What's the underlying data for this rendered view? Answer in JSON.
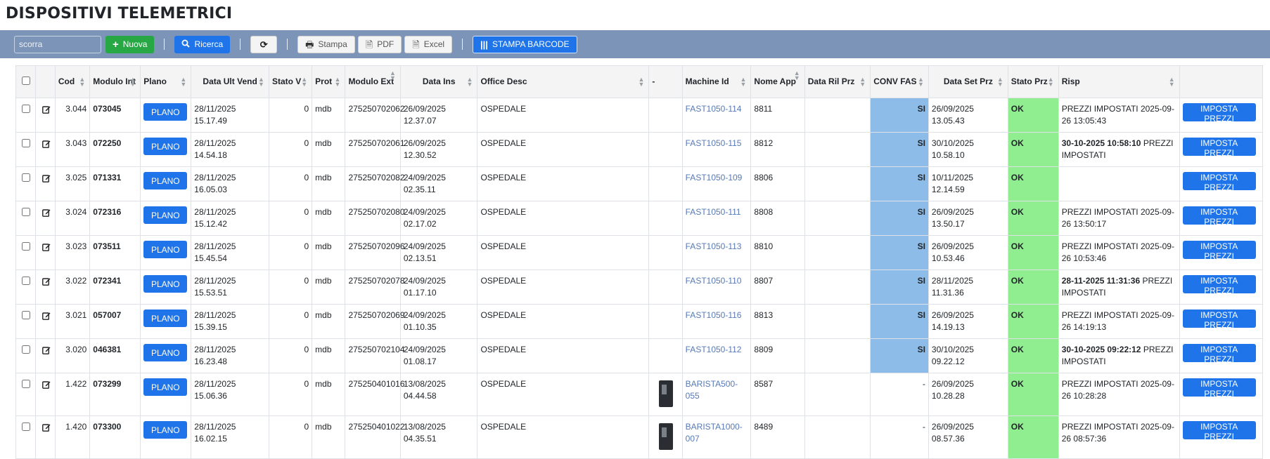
{
  "page": {
    "title": "DISPOSITIVI TELEMETRICI"
  },
  "toolbar": {
    "search_value": "scorra",
    "nuova_label": "Nuova",
    "ricerca_label": "Ricerca",
    "stampa_label": "Stampa",
    "pdf_label": "PDF",
    "excel_label": "Excel",
    "barcode_label": "STAMPA BARCODE"
  },
  "columns": {
    "cod": "Cod",
    "modulo_int": "Modulo Int",
    "plano": "Plano",
    "data_ult_vend": "Data Ult Vend",
    "stato_v": "Stato V",
    "prot": "Prot",
    "modulo_ext": "Modulo Ext",
    "data_ins": "Data Ins",
    "office_desc": "Office Desc",
    "dash": "-",
    "machine_id": "Machine Id",
    "nome_app": "Nome App",
    "data_ril_prz": "Data Ril Prz",
    "conv_fas": "CONV FAS",
    "data_set_prz": "Data Set Prz",
    "stato_prz": "Stato Prz",
    "risp": "Risp"
  },
  "buttons": {
    "plano": "PLANO",
    "imposta": "IMPOSTA PREZZI"
  },
  "rows": [
    {
      "cod": "3.044",
      "modulo_int": "073045",
      "data_ult_vend": "28/11/2025 15.17.49",
      "stato_v": "0",
      "prot": "mdb",
      "modulo_ext": "275250702062",
      "data_ins": "26/09/2025 12.37.07",
      "office_desc": "OSPEDALE",
      "dash": "",
      "machine_id": "FAST1050-114",
      "nome_app": "8811",
      "data_ril_prz": "",
      "conv_fas": "SI",
      "data_set_prz": "26/09/2025 13.05.43",
      "stato_prz": "OK",
      "risp_bold": "",
      "risp": "PREZZI IMPOSTATI 2025-09-26 13:05:43"
    },
    {
      "cod": "3.043",
      "modulo_int": "072250",
      "data_ult_vend": "28/11/2025 14.54.18",
      "stato_v": "0",
      "prot": "mdb",
      "modulo_ext": "275250702061",
      "data_ins": "26/09/2025 12.30.52",
      "office_desc": "OSPEDALE",
      "dash": "",
      "machine_id": "FAST1050-115",
      "nome_app": "8812",
      "data_ril_prz": "",
      "conv_fas": "SI",
      "data_set_prz": "30/10/2025 10.58.10",
      "stato_prz": "OK",
      "risp_bold": "30-10-2025 10:58:10",
      "risp": " PREZZI IMPOSTATI"
    },
    {
      "cod": "3.025",
      "modulo_int": "071331",
      "data_ult_vend": "28/11/2025 16.05.03",
      "stato_v": "0",
      "prot": "mdb",
      "modulo_ext": "275250702082",
      "data_ins": "24/09/2025 02.35.11",
      "office_desc": "OSPEDALE",
      "dash": "",
      "machine_id": "FAST1050-109",
      "nome_app": "8806",
      "data_ril_prz": "",
      "conv_fas": "SI",
      "data_set_prz": "10/11/2025 12.14.59",
      "stato_prz": "OK",
      "risp_bold": "",
      "risp": ""
    },
    {
      "cod": "3.024",
      "modulo_int": "072316",
      "data_ult_vend": "28/11/2025 15.12.42",
      "stato_v": "0",
      "prot": "mdb",
      "modulo_ext": "275250702080",
      "data_ins": "24/09/2025 02.17.02",
      "office_desc": "OSPEDALE",
      "dash": "",
      "machine_id": "FAST1050-111",
      "nome_app": "8808",
      "data_ril_prz": "",
      "conv_fas": "SI",
      "data_set_prz": "26/09/2025 13.50.17",
      "stato_prz": "OK",
      "risp_bold": "",
      "risp": "PREZZI IMPOSTATI 2025-09-26 13:50:17"
    },
    {
      "cod": "3.023",
      "modulo_int": "073511",
      "data_ult_vend": "28/11/2025 15.45.54",
      "stato_v": "0",
      "prot": "mdb",
      "modulo_ext": "275250702096",
      "data_ins": "24/09/2025 02.13.51",
      "office_desc": "OSPEDALE",
      "dash": "",
      "machine_id": "FAST1050-113",
      "nome_app": "8810",
      "data_ril_prz": "",
      "conv_fas": "SI",
      "data_set_prz": "26/09/2025 10.53.46",
      "stato_prz": "OK",
      "risp_bold": "",
      "risp": "PREZZI IMPOSTATI 2025-09-26 10:53:46"
    },
    {
      "cod": "3.022",
      "modulo_int": "072341",
      "data_ult_vend": "28/11/2025 15.53.51",
      "stato_v": "0",
      "prot": "mdb",
      "modulo_ext": "275250702078",
      "data_ins": "24/09/2025 01.17.10",
      "office_desc": "OSPEDALE",
      "dash": "",
      "machine_id": "FAST1050-110",
      "nome_app": "8807",
      "data_ril_prz": "",
      "conv_fas": "SI",
      "data_set_prz": "28/11/2025 11.31.36",
      "stato_prz": "OK",
      "risp_bold": "28-11-2025 11:31:36",
      "risp": " PREZZI IMPOSTATI"
    },
    {
      "cod": "3.021",
      "modulo_int": "057007",
      "data_ult_vend": "28/11/2025 15.39.15",
      "stato_v": "0",
      "prot": "mdb",
      "modulo_ext": "275250702069",
      "data_ins": "24/09/2025 01.10.35",
      "office_desc": "OSPEDALE",
      "dash": "",
      "machine_id": "FAST1050-116",
      "nome_app": "8813",
      "data_ril_prz": "",
      "conv_fas": "SI",
      "data_set_prz": "26/09/2025 14.19.13",
      "stato_prz": "OK",
      "risp_bold": "",
      "risp": "PREZZI IMPOSTATI 2025-09-26 14:19:13"
    },
    {
      "cod": "3.020",
      "modulo_int": "046381",
      "data_ult_vend": "28/11/2025 16.23.48",
      "stato_v": "0",
      "prot": "mdb",
      "modulo_ext": "275250702104",
      "data_ins": "24/09/2025 01.08.17",
      "office_desc": "OSPEDALE",
      "dash": "",
      "machine_id": "FAST1050-112",
      "nome_app": "8809",
      "data_ril_prz": "",
      "conv_fas": "SI",
      "data_set_prz": "30/10/2025 09.22.12",
      "stato_prz": "OK",
      "risp_bold": "30-10-2025 09:22:12",
      "risp": " PREZZI IMPOSTATI"
    },
    {
      "cod": "1.422",
      "modulo_int": "073299",
      "data_ult_vend": "28/11/2025 15.06.36",
      "stato_v": "0",
      "prot": "mdb",
      "modulo_ext": "275250401016",
      "data_ins": "13/08/2025 04.44.58",
      "office_desc": "OSPEDALE",
      "dash": "img",
      "machine_id": "BARISTA500-055",
      "nome_app": "8587",
      "data_ril_prz": "",
      "conv_fas": "-",
      "data_set_prz": "26/09/2025 10.28.28",
      "stato_prz": "OK",
      "risp_bold": "",
      "risp": "PREZZI IMPOSTATI 2025-09-26 10:28:28"
    },
    {
      "cod": "1.420",
      "modulo_int": "073300",
      "data_ult_vend": "28/11/2025 16.02.15",
      "stato_v": "0",
      "prot": "mdb",
      "modulo_ext": "275250401022",
      "data_ins": "13/08/2025 04.35.51",
      "office_desc": "OSPEDALE",
      "dash": "img",
      "machine_id": "BARISTA1000-007",
      "nome_app": "8489",
      "data_ril_prz": "",
      "conv_fas": "-",
      "data_set_prz": "26/09/2025 08.57.36",
      "stato_prz": "OK",
      "risp_bold": "",
      "risp": "PREZZI IMPOSTATI 2025-09-26 08:57:36"
    }
  ],
  "colors": {
    "toolbar_bg": "#7b94b8",
    "primary": "#1e74e8",
    "success": "#28a745",
    "conv_bg": "#8dbce9",
    "ok_bg": "#90ee90",
    "link": "#5779b5"
  },
  "icons": {
    "add": "plus-icon",
    "search": "search-icon",
    "refresh": "refresh-icon",
    "print": "print-icon",
    "pdf": "pdf-icon",
    "excel": "excel-icon",
    "barcode": "barcode-icon",
    "edit": "edit-icon",
    "sort": "sort-icon"
  }
}
